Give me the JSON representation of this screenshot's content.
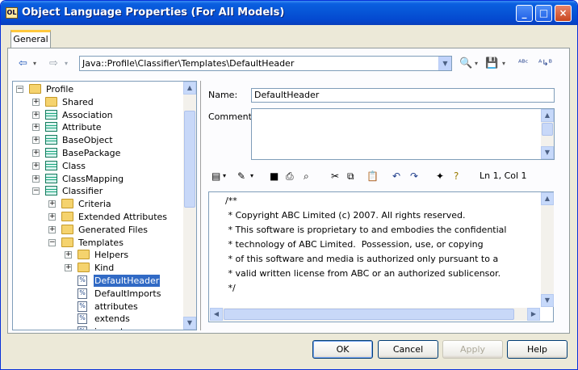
{
  "window": {
    "title": "Object Language Properties (For All Models)",
    "app_icon": "OL"
  },
  "titlebar_buttons": {
    "minimize": "_",
    "maximize": "□",
    "close": "×"
  },
  "tabs": [
    {
      "label": "General"
    }
  ],
  "nav": {
    "back_icon": "⇦",
    "forward_icon": "⇨",
    "path": "Java::Profile\\Classifier\\Templates\\DefaultHeader"
  },
  "tree": {
    "items": [
      {
        "label": "Profile",
        "icon": "folder-icon",
        "expander": "−",
        "level": 0
      },
      {
        "label": "Shared",
        "icon": "folder-icon",
        "expander": "+",
        "level": 1
      },
      {
        "label": "Association",
        "icon": "class-icon",
        "expander": "+",
        "level": 1
      },
      {
        "label": "Attribute",
        "icon": "class-icon",
        "expander": "+",
        "level": 1
      },
      {
        "label": "BaseObject",
        "icon": "class-icon",
        "expander": "+",
        "level": 1
      },
      {
        "label": "BasePackage",
        "icon": "class-icon",
        "expander": "+",
        "level": 1
      },
      {
        "label": "Class",
        "icon": "class-icon",
        "expander": "+",
        "level": 1
      },
      {
        "label": "ClassMapping",
        "icon": "class-icon",
        "expander": "+",
        "level": 1
      },
      {
        "label": "Classifier",
        "icon": "class-icon",
        "expander": "−",
        "level": 1
      },
      {
        "label": "Criteria",
        "icon": "folder-icon",
        "expander": "+",
        "level": 2
      },
      {
        "label": "Extended Attributes",
        "icon": "folder-icon",
        "expander": "+",
        "level": 2
      },
      {
        "label": "Generated Files",
        "icon": "folder-icon",
        "expander": "+",
        "level": 2
      },
      {
        "label": "Templates",
        "icon": "folder-icon",
        "expander": "−",
        "level": 2
      },
      {
        "label": "Helpers",
        "icon": "folder-icon",
        "expander": "+",
        "level": 3
      },
      {
        "label": "Kind",
        "icon": "folder-icon",
        "expander": "+",
        "level": 3
      },
      {
        "label": "DefaultHeader",
        "icon": "template-icon",
        "expander": "",
        "level": 3,
        "selected": true
      },
      {
        "label": "DefaultImports",
        "icon": "template-icon",
        "expander": "",
        "level": 3
      },
      {
        "label": "attributes",
        "icon": "template-icon",
        "expander": "",
        "level": 3
      },
      {
        "label": "extends",
        "icon": "template-icon",
        "expander": "",
        "level": 3
      },
      {
        "label": "imports",
        "icon": "template-icon",
        "expander": "",
        "level": 3
      }
    ]
  },
  "form": {
    "name_label": "Name:",
    "name_value": "DefaultHeader",
    "comment_label": "Comment:",
    "comment_value": ""
  },
  "editor": {
    "cursor_pos": "Ln 1, Col 1",
    "lines": [
      "/**",
      " * Copyright ABC Limited (c) 2007. All rights reserved.",
      " * This software is proprietary to and embodies the confidential",
      " * technology of ABC Limited.  Possession, use, or copying",
      " * of this software and media is authorized only pursuant to a",
      " * valid written license from ABC or an authorized sublicensor.",
      " */"
    ]
  },
  "buttons": {
    "ok": "OK",
    "cancel": "Cancel",
    "apply": "Apply",
    "help": "Help"
  },
  "colors": {
    "title_bar": "#0757d8",
    "selection": "#316ac5",
    "window_bg": "#ece9d8"
  }
}
